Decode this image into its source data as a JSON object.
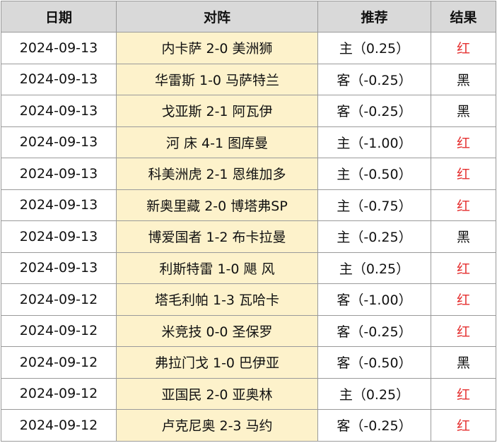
{
  "headers": {
    "date": "日期",
    "match": "对阵",
    "pick": "推荐",
    "result": "结果"
  },
  "rows": [
    {
      "date": "2024-09-13",
      "match": "内卡萨 2-0 美洲狮",
      "pick": "主（0.25）",
      "result": "红"
    },
    {
      "date": "2024-09-13",
      "match": "华雷斯 1-0 马萨特兰",
      "pick": "客（-0.25）",
      "result": "黑"
    },
    {
      "date": "2024-09-13",
      "match": "戈亚斯 2-1 阿瓦伊",
      "pick": "客（-0.25）",
      "result": "黑"
    },
    {
      "date": "2024-09-13",
      "match": "河 床 4-1 图库曼",
      "pick": "主（-1.00）",
      "result": "红"
    },
    {
      "date": "2024-09-13",
      "match": "科美洲虎 2-1 恩维加多",
      "pick": "主（-0.50）",
      "result": "红"
    },
    {
      "date": "2024-09-13",
      "match": "新奥里藏 2-0 博塔弗SP",
      "pick": "主（-0.75）",
      "result": "红"
    },
    {
      "date": "2024-09-13",
      "match": "博爱国者 1-2 布卡拉曼",
      "pick": "主（-0.25）",
      "result": "黑"
    },
    {
      "date": "2024-09-13",
      "match": "利斯特雷 1-0 飓 风",
      "pick": "主（0.25）",
      "result": "红"
    },
    {
      "date": "2024-09-12",
      "match": "塔毛利帕 1-3 瓦哈卡",
      "pick": "客（-1.00）",
      "result": "红"
    },
    {
      "date": "2024-09-12",
      "match": "米竞技 0-0 圣保罗",
      "pick": "客（-0.25）",
      "result": "红"
    },
    {
      "date": "2024-09-12",
      "match": "弗拉门戈 1-0 巴伊亚",
      "pick": "客（-0.50）",
      "result": "黑"
    },
    {
      "date": "2024-09-12",
      "match": "亚国民 2-0 亚奥林",
      "pick": "主（0.25）",
      "result": "红"
    },
    {
      "date": "2024-09-12",
      "match": "卢克尼奥 2-3 马约",
      "pick": "客（-0.25）",
      "result": "红"
    }
  ],
  "colors": {
    "header_bg": "#d9d9d9",
    "match_bg": "#fdf2cb",
    "result_red": "#e53030",
    "result_black": "#111111",
    "border": "#9a9a9a"
  }
}
